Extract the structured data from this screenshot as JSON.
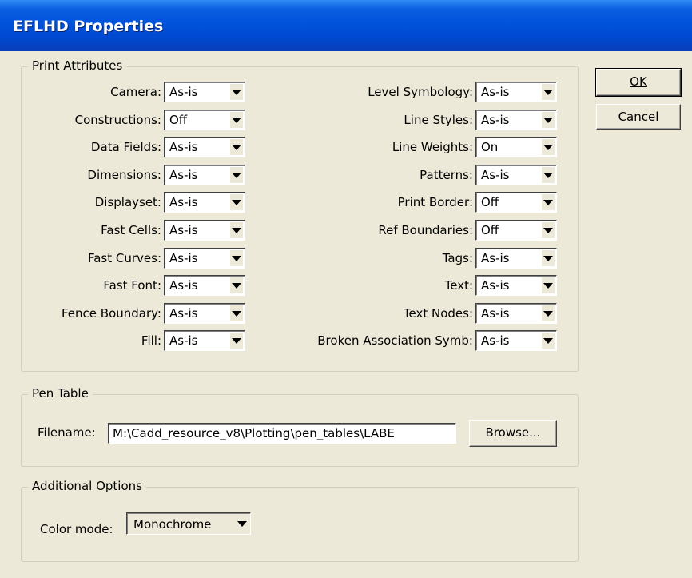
{
  "window": {
    "title": "EFLHD Properties"
  },
  "buttons": {
    "ok": "OK",
    "cancel": "Cancel",
    "browse": "Browse..."
  },
  "print_attributes": {
    "legend": "Print Attributes",
    "left": [
      {
        "label": "Camera:",
        "value": "As-is"
      },
      {
        "label": "Constructions:",
        "value": "Off"
      },
      {
        "label": "Data Fields:",
        "value": "As-is"
      },
      {
        "label": "Dimensions:",
        "value": "As-is"
      },
      {
        "label": "Displayset:",
        "value": "As-is"
      },
      {
        "label": "Fast Cells:",
        "value": "As-is"
      },
      {
        "label": "Fast Curves:",
        "value": "As-is"
      },
      {
        "label": "Fast Font:",
        "value": "As-is"
      },
      {
        "label": "Fence Boundary:",
        "value": "As-is"
      },
      {
        "label": "Fill:",
        "value": "As-is"
      }
    ],
    "right": [
      {
        "label": "Level Symbology:",
        "value": "As-is"
      },
      {
        "label": "Line Styles:",
        "value": "As-is"
      },
      {
        "label": "Line Weights:",
        "value": "On"
      },
      {
        "label": "Patterns:",
        "value": "As-is"
      },
      {
        "label": "Print Border:",
        "value": "Off"
      },
      {
        "label": "Ref Boundaries:",
        "value": "Off"
      },
      {
        "label": "Tags:",
        "value": "As-is"
      },
      {
        "label": "Text:",
        "value": "As-is"
      },
      {
        "label": "Text Nodes:",
        "value": "As-is"
      },
      {
        "label": "Broken Association Symb:",
        "value": "As-is"
      }
    ]
  },
  "pen_table": {
    "legend": "Pen Table",
    "filename_label": "Filename:",
    "filename_value": "M:\\Cadd_resource_v8\\Plotting\\pen_tables\\LABE"
  },
  "additional_options": {
    "legend": "Additional Options",
    "color_mode_label": "Color mode:",
    "color_mode_value": "Monochrome"
  }
}
